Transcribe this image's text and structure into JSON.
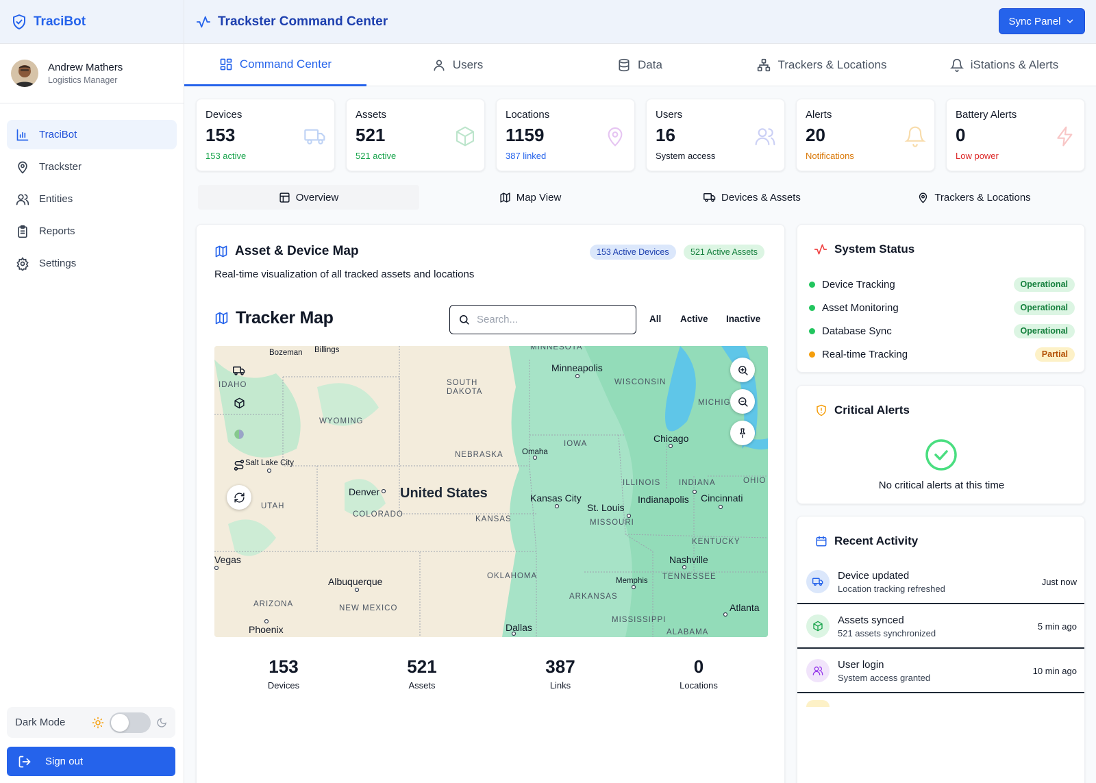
{
  "brand": {
    "name": "TraciBot"
  },
  "profile": {
    "name": "Andrew Mathers",
    "role": "Logistics Manager"
  },
  "sidebar": {
    "items": [
      {
        "label": "TraciBot",
        "icon": "bar-chart-icon",
        "active": true
      },
      {
        "label": "Trackster",
        "icon": "map-pin-icon"
      },
      {
        "label": "Entities",
        "icon": "users-icon"
      },
      {
        "label": "Reports",
        "icon": "clipboard-icon"
      },
      {
        "label": "Settings",
        "icon": "gear-icon"
      }
    ],
    "dark_mode_label": "Dark Mode",
    "dark_mode_on": false,
    "sign_out_label": "Sign out"
  },
  "header": {
    "title": "Trackster Command Center",
    "sync_label": "Sync Panel"
  },
  "tabs": [
    {
      "label": "Command Center",
      "active": true
    },
    {
      "label": "Users"
    },
    {
      "label": "Data"
    },
    {
      "label": "Trackers & Locations"
    },
    {
      "label": "iStations & Alerts"
    }
  ],
  "stats": [
    {
      "label": "Devices",
      "value": "153",
      "sub": "153 active",
      "sub_color": "#16a34a",
      "icon": "truck-icon"
    },
    {
      "label": "Assets",
      "value": "521",
      "sub": "521 active",
      "sub_color": "#16a34a",
      "icon": "box-icon"
    },
    {
      "label": "Locations",
      "value": "1159",
      "sub": "387 linked",
      "sub_color": "#2563eb",
      "icon": "map-pin-icon"
    },
    {
      "label": "Users",
      "value": "16",
      "sub": "System access",
      "sub_color": "#111827",
      "icon": "users-icon"
    },
    {
      "label": "Alerts",
      "value": "20",
      "sub": "Notifications",
      "sub_color": "#d97706",
      "icon": "bell-icon"
    },
    {
      "label": "Battery Alerts",
      "value": "0",
      "sub": "Low power",
      "sub_color": "#dc2626",
      "icon": "lightning-icon"
    }
  ],
  "subtabs": [
    {
      "label": "Overview",
      "active": true
    },
    {
      "label": "Map View"
    },
    {
      "label": "Devices & Assets"
    },
    {
      "label": "Trackers & Locations"
    }
  ],
  "map_panel": {
    "title": "Asset & Device Map",
    "description": "Real-time visualization of all tracked assets and locations",
    "badge_devices": "153 Active Devices",
    "badge_assets": "521 Active Assets",
    "tracker_title": "Tracker Map",
    "search_placeholder": "Search...",
    "filters": [
      "All",
      "Active",
      "Inactive"
    ]
  },
  "map": {
    "country": "United States",
    "states": [
      "MINNESOTA",
      "SOUTH DAKOTA",
      "WISCONSIN",
      "MICHIG",
      "IDAHO",
      "WYOMING",
      "IOWA",
      "NEBRASKA",
      "ILLINOIS",
      "INDIANA",
      "OHIO",
      "UTAH",
      "COLORADO",
      "KANSAS",
      "MISSOURI",
      "KENTUCKY",
      "TENNESSEE",
      "OKLAHOMA",
      "ARKANSAS",
      "ARIZONA",
      "NEW MEXICO",
      "MISSISSIPPI",
      "ALABAMA"
    ],
    "cities": [
      "Bozeman",
      "Billings",
      "Minneapolis",
      "Chicago",
      "Omaha",
      "Salt Lake City",
      "Denver",
      "Kansas City",
      "St. Louis",
      "Indianapolis",
      "Cincinnati",
      "Vegas",
      "Nashville",
      "Albuquerque",
      "Memphis",
      "Atlanta",
      "Phoenix",
      "Dallas"
    ]
  },
  "bottom_stats": [
    {
      "value": "153",
      "label": "Devices"
    },
    {
      "value": "521",
      "label": "Assets"
    },
    {
      "value": "387",
      "label": "Links"
    },
    {
      "value": "0",
      "label": "Locations"
    }
  ],
  "system_status": {
    "title": "System Status",
    "items": [
      {
        "name": "Device Tracking",
        "status": "Operational",
        "color": "#22c55e"
      },
      {
        "name": "Asset Monitoring",
        "status": "Operational",
        "color": "#22c55e"
      },
      {
        "name": "Database Sync",
        "status": "Operational",
        "color": "#22c55e"
      },
      {
        "name": "Real-time Tracking",
        "status": "Partial",
        "color": "#f59e0b"
      }
    ]
  },
  "critical_alerts": {
    "title": "Critical Alerts",
    "message": "No critical alerts at this time"
  },
  "recent_activity": {
    "title": "Recent Activity",
    "items": [
      {
        "title": "Device updated",
        "sub": "Location tracking refreshed",
        "time": "Just now",
        "icon": "truck-icon"
      },
      {
        "title": "Assets synced",
        "sub": "521 assets synchronized",
        "time": "5 min ago",
        "icon": "box-icon"
      },
      {
        "title": "User login",
        "sub": "System access granted",
        "time": "10 min ago",
        "icon": "users-icon"
      }
    ]
  }
}
